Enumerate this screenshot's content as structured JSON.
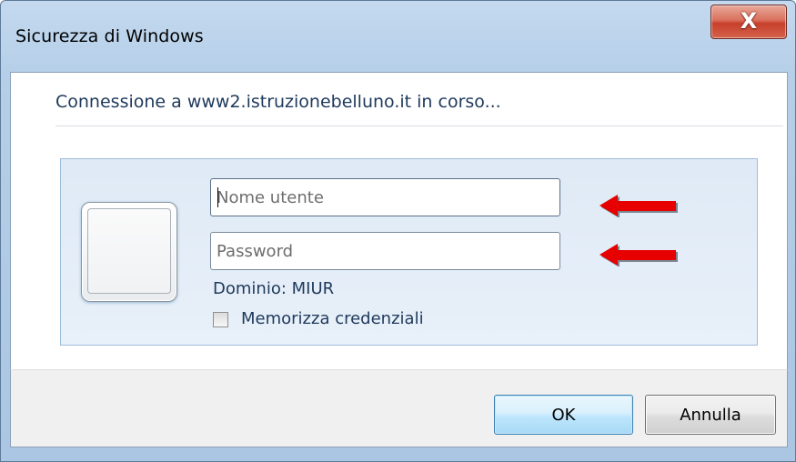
{
  "window": {
    "title": "Sicurezza di Windows",
    "close_glyph": "X"
  },
  "message": {
    "connecting": "Connessione a www2.istruzionebelluno.it in corso..."
  },
  "credentials": {
    "username_placeholder": "Nome utente",
    "username_value": "",
    "password_placeholder": "Password",
    "password_value": "",
    "domain": "Dominio: MIUR",
    "remember_label": "Memorizza credenziali",
    "remember_checked": false
  },
  "annotations": {
    "arrow_color": "#e60000",
    "arrow_icon": "arrow-left-icon"
  },
  "buttons": {
    "ok": "OK",
    "cancel": "Annulla"
  },
  "colors": {
    "frame": "#b6cfe8",
    "panel": "#dfeaf6",
    "text": "#1e395b",
    "close_button": "#c7402b"
  }
}
